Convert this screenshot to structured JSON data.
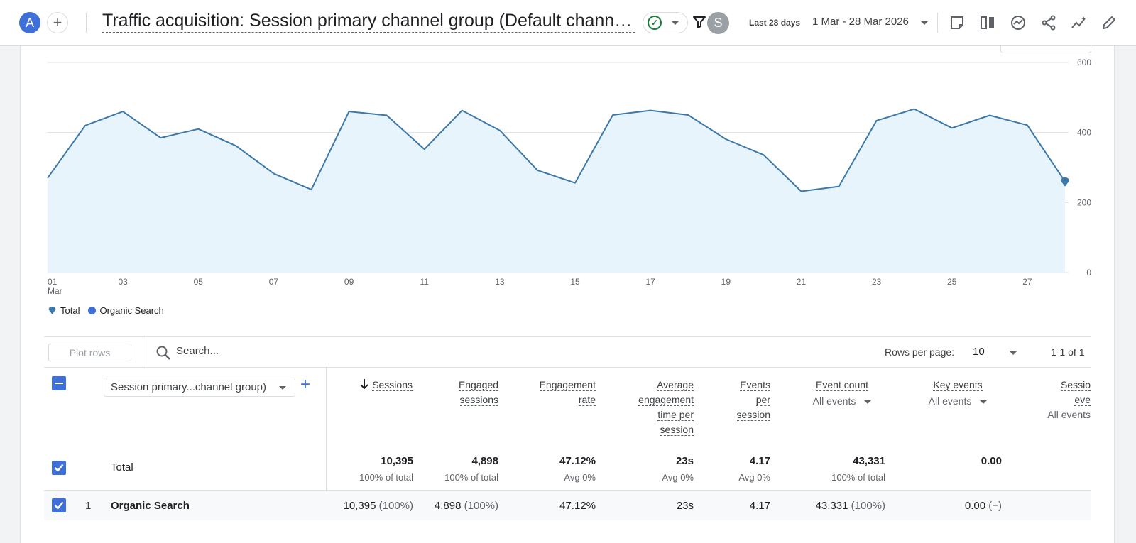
{
  "topbar": {
    "user_initial": "A",
    "report_title": "Traffic acquisition: Session primary channel group (Default channel group)",
    "user_avatar": "S",
    "date_preset": "Last 28 days",
    "date_range": "1 Mar - 28 Mar 2026",
    "icons": [
      "add-icon",
      "check-circle-icon",
      "filter-icon",
      "note-icon",
      "compare-icon",
      "insights-icon",
      "share-icon",
      "trend-icon",
      "edit-icon"
    ]
  },
  "chart_data": {
    "type": "area",
    "x": [
      "01",
      "02",
      "03",
      "04",
      "05",
      "06",
      "07",
      "08",
      "09",
      "10",
      "11",
      "12",
      "13",
      "14",
      "15",
      "16",
      "17",
      "18",
      "19",
      "20",
      "21",
      "22",
      "23",
      "24",
      "25",
      "26",
      "27",
      "28"
    ],
    "x_tick_labels": [
      "01\nMar",
      "03",
      "05",
      "07",
      "09",
      "11",
      "13",
      "15",
      "17",
      "19",
      "21",
      "23",
      "25",
      "27"
    ],
    "series": [
      {
        "name": "Total",
        "values": [
          270,
          420,
          460,
          385,
          410,
          362,
          283,
          237,
          460,
          449,
          352,
          463,
          406,
          292,
          256,
          450,
          463,
          450,
          381,
          336,
          232,
          246,
          434,
          467,
          413,
          449,
          421,
          260
        ]
      }
    ],
    "ylim": [
      0,
      600
    ],
    "y_ticks": [
      "0",
      "200",
      "400",
      "600"
    ],
    "grid": true,
    "legend": [
      {
        "label": "Total",
        "marker": "pin",
        "color": "#1a73e8"
      },
      {
        "label": "Organic Search",
        "marker": "dot",
        "color": "#3f6fd8"
      }
    ],
    "colors": {
      "line": "#3c78a8",
      "fill": "#e8f4fc"
    }
  },
  "table": {
    "plot_rows_label": "Plot rows",
    "search_placeholder": "Search...",
    "rows_per_page_label": "Rows per page:",
    "rows_per_page_value": "10",
    "pager_text": "1-1 of 1",
    "dimension_label": "Session primary...channel group)",
    "columns": {
      "sessions": "Sessions",
      "engaged": [
        "Engaged",
        "sessions"
      ],
      "engagement_rate": [
        "Engagement",
        "rate"
      ],
      "avg_time": [
        "Average",
        "engagement",
        "time per",
        "session"
      ],
      "events_per": [
        "Events",
        "per",
        "session"
      ],
      "event_count": "Event count",
      "key_events": "Key events",
      "session_key": [
        "Sessio",
        "eve"
      ],
      "all_events": "All events"
    },
    "total": {
      "label": "Total",
      "sessions": "10,395",
      "sessions_sub": "100% of total",
      "engaged": "4,898",
      "engaged_sub": "100% of total",
      "engagement_rate": "47.12%",
      "engagement_rate_sub": "Avg 0%",
      "avg_time": "23s",
      "avg_time_sub": "Avg 0%",
      "events_per": "4.17",
      "events_per_sub": "Avg 0%",
      "event_count": "43,331",
      "event_count_sub": "100% of total",
      "key_events": "0.00"
    },
    "rows": [
      {
        "index": "1",
        "name": "Organic Search",
        "sessions": "10,395",
        "sessions_pct": "(100%)",
        "engaged": "4,898",
        "engaged_pct": "(100%)",
        "engagement_rate": "47.12%",
        "avg_time": "23s",
        "events_per": "4.17",
        "event_count": "43,331",
        "event_count_pct": "(100%)",
        "key_events": "0.00",
        "key_events_pct": "(−)"
      }
    ]
  }
}
